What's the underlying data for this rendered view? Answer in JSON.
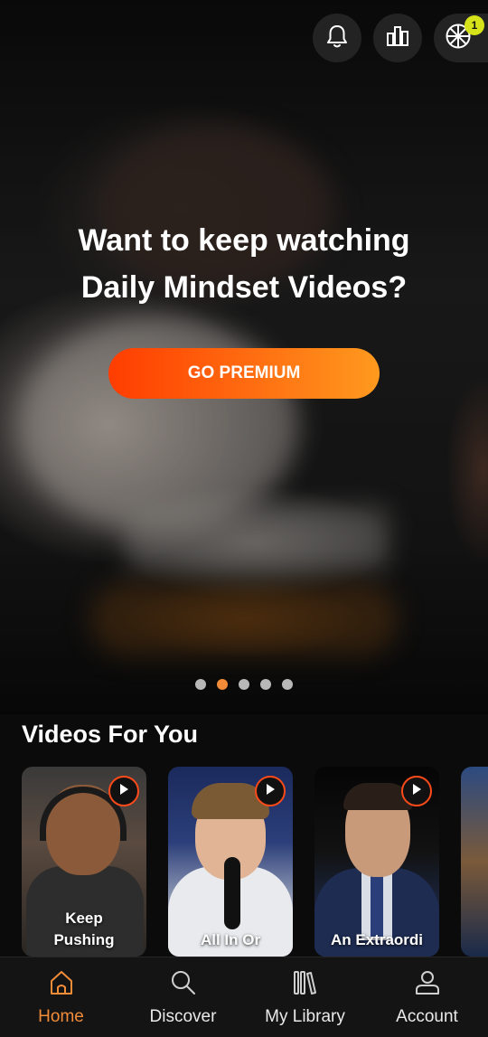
{
  "header": {
    "notifications_icon": "bell-icon",
    "stats_icon": "bar-chart-icon",
    "wheel_icon": "wheel-icon",
    "wheel_badge": "1"
  },
  "hero": {
    "title_line1": "Want to keep watching",
    "title_line2": "Daily Mindset Videos?",
    "cta_label": "GO PREMIUM",
    "carousel_pages": 5,
    "carousel_active_index": 1
  },
  "videos_section": {
    "title": "Videos For You",
    "items": [
      {
        "label": "Keep Pushing"
      },
      {
        "label": "All In Or"
      },
      {
        "label": "An Extraordi"
      }
    ]
  },
  "bottom_nav": {
    "items": [
      {
        "label": "Home",
        "icon": "home-icon",
        "active": true
      },
      {
        "label": "Discover",
        "icon": "search-icon",
        "active": false
      },
      {
        "label": "My Library",
        "icon": "library-icon",
        "active": false
      },
      {
        "label": "Account",
        "icon": "user-icon",
        "active": false
      }
    ]
  },
  "colors": {
    "accent": "#f28c38",
    "premium_gradient_start": "#ff3d00",
    "premium_gradient_end": "#ff9a1e",
    "badge": "#d6e21a"
  }
}
